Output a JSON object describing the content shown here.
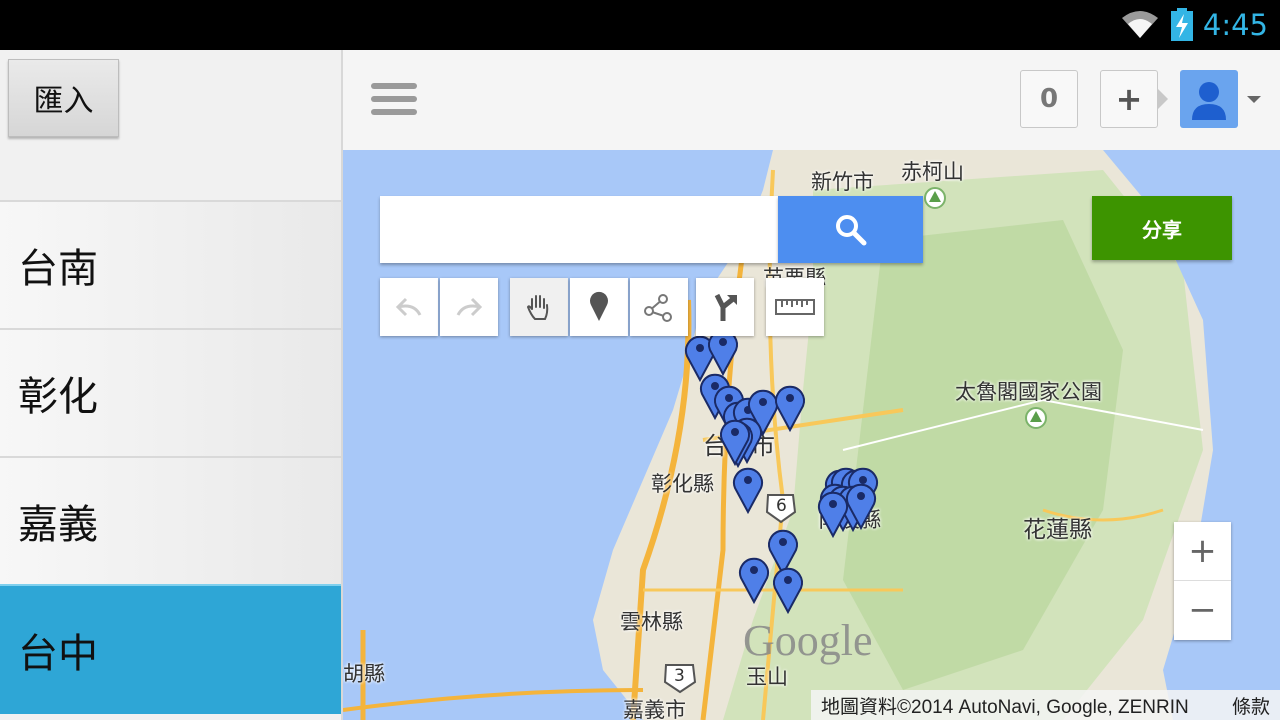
{
  "status_bar": {
    "time": "4:45",
    "icons": [
      "wifi-icon",
      "battery-charging-icon"
    ],
    "accent_color": "#33b5e5"
  },
  "sidebar": {
    "import_label": "匯入",
    "items": [
      {
        "label": "台南",
        "selected": false
      },
      {
        "label": "彰化",
        "selected": false
      },
      {
        "label": "嘉義",
        "selected": false
      },
      {
        "label": "台中",
        "selected": true
      }
    ],
    "selected_color": "#2ea6d6"
  },
  "toolbar": {
    "menu_icon": "hamburger-menu-icon",
    "count": "0",
    "add_label": "+",
    "avatar_icon": "user-avatar-icon"
  },
  "map": {
    "search": {
      "placeholder": "",
      "value": ""
    },
    "share_label": "分享",
    "share_color": "#3d9400",
    "tools": [
      "undo-icon",
      "redo-icon",
      "pan-hand-icon",
      "add-marker-icon",
      "draw-line-icon",
      "directions-icon",
      "ruler-icon"
    ],
    "zoom_in": "+",
    "zoom_out": "−",
    "google_logo": "Google",
    "attribution": "地圖資料©2014 AutoNavi, Google, ZENRIN",
    "terms": "條款",
    "labels": {
      "hsinchu": "新竹市",
      "chiyoushan": "赤柯山",
      "miaoli": "苗栗縣",
      "taroko": "太魯閣國家公園",
      "taichung": "台中市",
      "changhua": "彰化縣",
      "nantou": "南投縣",
      "hualien": "花蓮縣",
      "yunlin": "雲林縣",
      "chiayi": "嘉義市",
      "yushan": "玉山",
      "penghu_partial": "胡縣",
      "route6": "6",
      "route3": "3"
    },
    "marker_color": "#4f7fe8",
    "marker_count": 24
  }
}
